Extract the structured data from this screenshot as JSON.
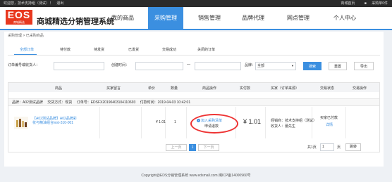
{
  "topbar": {
    "welcome": "欢迎您，技术支持组（测试）！",
    "logout": "退出",
    "mall_home": "商城首页",
    "purchase_order": "采购单0件"
  },
  "header": {
    "logo_text": "EOS",
    "logo_sub": "商城精选",
    "site_name": "商城精选分销管理系统",
    "nav": [
      {
        "label": "我的商品"
      },
      {
        "label": "采购管理"
      },
      {
        "label": "销售管理"
      },
      {
        "label": "品牌代理"
      },
      {
        "label": "网点管理"
      },
      {
        "label": "个人中心"
      }
    ]
  },
  "breadcrumb": "采购管理 > 已采购商品",
  "tabs": [
    {
      "label": "全部订单"
    },
    {
      "label": "待付款"
    },
    {
      "label": "待发货"
    },
    {
      "label": "已发货"
    },
    {
      "label": "交易成功"
    },
    {
      "label": "关闭的订单"
    }
  ],
  "filters": {
    "order_label": "订单编号或收货人：",
    "order_value": "",
    "created_label": "创建时间：",
    "date_sep": "—",
    "date_from": "",
    "date_to": "",
    "brand_label": "品牌：",
    "brand_value": "全部",
    "search": "搜索",
    "reset": "重置",
    "export": "导出"
  },
  "table": {
    "headers": [
      "商品",
      "买家留言",
      "单价",
      "数量",
      "商品操作",
      "实付款",
      "买家（订单来源）",
      "交易状态",
      "交易操作"
    ],
    "order_info": {
      "brand": "品牌：A02测试品牌",
      "method": "交货方式：现货",
      "order_no": "订单号：EDSFX20190403104110693",
      "paid_time": "付款时间：2019-04-03 10:42:01"
    },
    "row": {
      "product_name": "【A02测试品牌】A02品牌彩妆与精油组合test-310-001",
      "unit_price": "¥ 1.01",
      "quantity": "1",
      "add_to_cart": "加入采购清单",
      "refund": "申请退款",
      "actual_paid": "¥ 1.01",
      "buyer": "经销商：技术支持组（测试）",
      "receiver": "收货人：蕾先生",
      "status": "买家已付款",
      "detail": "详情"
    }
  },
  "pagination": {
    "prev": "上一页",
    "current": "1",
    "next": "下一页",
    "total_label": "共1页",
    "goto_value": "1",
    "page_label": "页",
    "jump": "跳转"
  },
  "footer": "Copyright@EDS分销管理系统 www.edsmall.com 闽ICP备14000960号",
  "colors": {
    "accent": "#3b8fe0",
    "topbar": "#2b2b2b",
    "logo": "#e8381f",
    "highlight": "#e33333"
  }
}
